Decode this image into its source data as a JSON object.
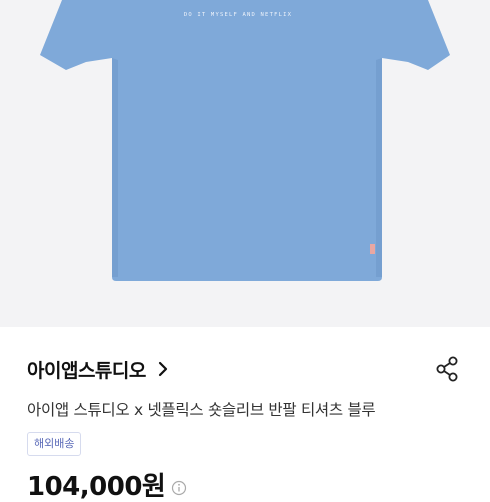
{
  "product_image": {
    "print_text": "DO IT MYSELF AND NETFLIX",
    "shirt_color": "#7fa9d9",
    "background_color": "#f3f3f5"
  },
  "brand": {
    "name": "아이앱스튜디오",
    "chevron_icon": "chevron-right-icon"
  },
  "share": {
    "icon": "share-icon"
  },
  "product": {
    "title": "아이앱 스튜디오 x 넷플릭스 숏슬리브 반팔 티셔츠 블루",
    "badge": "해외배송",
    "price": "104,000원",
    "price_info_icon": "info-circle-icon"
  },
  "colors": {
    "badge_text": "#5a6ab8",
    "badge_border": "#d6dbee",
    "text_primary": "#111111"
  }
}
